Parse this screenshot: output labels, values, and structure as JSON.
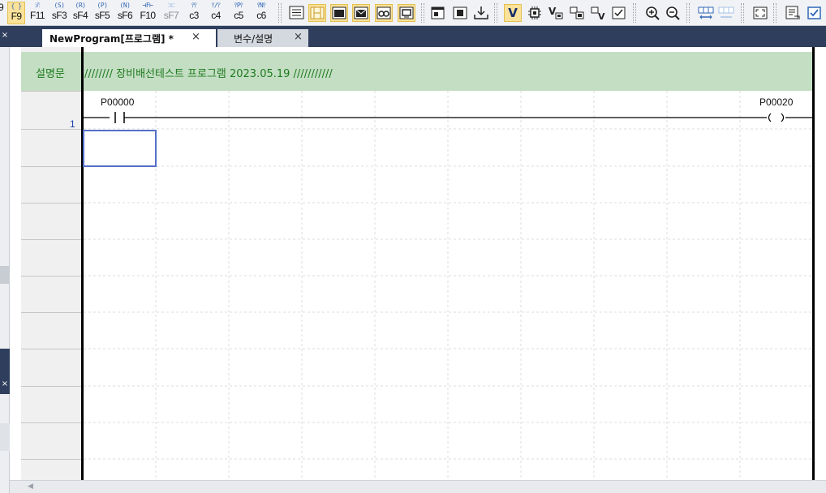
{
  "toolbar": {
    "keys": [
      {
        "sym": "",
        "label": "9",
        "disabled": false
      },
      {
        "sym": "{ }",
        "label": "F9",
        "disabled": false,
        "highlighted": true
      },
      {
        "sym": "⫶⫽⫶",
        "label": "F11",
        "disabled": false
      },
      {
        "sym": "(S)",
        "label": "sF3",
        "disabled": false
      },
      {
        "sym": "(R)",
        "label": "sF4",
        "disabled": false
      },
      {
        "sym": "(P)",
        "label": "sF5",
        "disabled": false
      },
      {
        "sym": "(N)",
        "label": "sF6",
        "disabled": false
      },
      {
        "sym": "⊣F⊢",
        "label": "F10",
        "disabled": false
      },
      {
        "sym": "⊐⊏",
        "label": "sF7",
        "disabled": true
      },
      {
        "sym": "⫯⫯",
        "label": "c3",
        "disabled": false
      },
      {
        "sym": "⫯/⫯",
        "label": "c4",
        "disabled": false
      },
      {
        "sym": "⫯P⫯",
        "label": "c5",
        "disabled": false
      },
      {
        "sym": "⫯N⫯",
        "label": "c6",
        "disabled": false
      }
    ],
    "icons": [
      "list-view-icon",
      "ladder-view-icon",
      "window-icon",
      "mail-icon",
      "glasses-icon",
      "monitor-icon",
      "properties-icon",
      "stop-icon",
      "download-icon",
      "variable-icon",
      "chip-icon",
      "variable-monitor-icon",
      "variable-copy-icon",
      "variable-edit-icon",
      "checkbox-icon",
      "zoom-in-icon",
      "zoom-out-icon",
      "expand-cols-icon",
      "shrink-cols-icon",
      "fit-screen-icon",
      "report-icon",
      "check-icon"
    ]
  },
  "left_panel": {
    "close_1": "×",
    "close_2": "×"
  },
  "tabs": [
    {
      "label": "NewProgram[프로그램] *",
      "close": "×",
      "active": true
    },
    {
      "label": "변수/설명",
      "close": "×",
      "active": false
    }
  ],
  "ladder": {
    "comment_label": "설명문",
    "comment_text": "//////// 장비배선테스트 프로그램 2023.05.19 ///////////",
    "rung_number": "1",
    "contact_device": "P00000",
    "coil_device": "P00020"
  },
  "scrollbar": {
    "left_arrow": "◀"
  }
}
